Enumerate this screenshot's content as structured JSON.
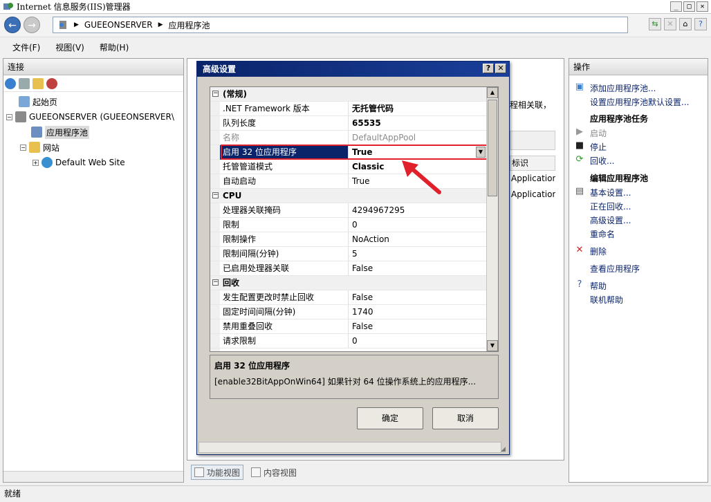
{
  "window": {
    "title": "Internet 信息服务(IIS)管理器",
    "controls": [
      "_",
      "□",
      "✕"
    ]
  },
  "address": {
    "crumbs": [
      "GUEEONSERVER",
      "应用程序池"
    ]
  },
  "menu": [
    "文件(F)",
    "视图(V)",
    "帮助(H)"
  ],
  "connections": {
    "header": "连接",
    "tree": {
      "start_page": "起始页",
      "server": "GUEEONSERVER (GUEEONSERVER\\",
      "app_pools": "应用程序池",
      "sites": "网站",
      "default_site": "Default Web Site"
    }
  },
  "center": {
    "text_fragment": "程相关联，",
    "col_header": "标识",
    "cells": [
      "Application",
      "Application"
    ],
    "view_tabs": [
      "功能视图",
      "内容视图"
    ]
  },
  "actions": {
    "header": "操作",
    "add_pool": "添加应用程序池...",
    "set_defaults": "设置应用程序池默认设置...",
    "tasks_heading": "应用程序池任务",
    "start": "启动",
    "stop": "停止",
    "recycle": "回收...",
    "edit_heading": "编辑应用程序池",
    "basic_settings": "基本设置...",
    "recycling": "正在回收...",
    "advanced_settings": "高级设置...",
    "rename": "重命名",
    "delete": "删除",
    "view_apps": "查看应用程序",
    "help": "帮助",
    "online_help": "联机帮助"
  },
  "status": "就绪",
  "dialog": {
    "title": "高级设置",
    "help_btn": "?",
    "close_btn": "✕",
    "categories": {
      "general": "(常规)",
      "cpu": "CPU",
      "recycling": "回收"
    },
    "props": {
      "p0": {
        "name": ".NET Framework 版本",
        "value": "无托管代码"
      },
      "p1": {
        "name": "队列长度",
        "value": "65535"
      },
      "p2": {
        "name": "名称",
        "value": "DefaultAppPool"
      },
      "p3": {
        "name": "启用 32 位应用程序",
        "value": "True"
      },
      "p4": {
        "name": "托管管道模式",
        "value": "Classic"
      },
      "p5": {
        "name": "自动启动",
        "value": "True"
      },
      "p6": {
        "name": "处理器关联掩码",
        "value": "4294967295"
      },
      "p7": {
        "name": "限制",
        "value": "0"
      },
      "p8": {
        "name": "限制操作",
        "value": "NoAction"
      },
      "p9": {
        "name": "限制间隔(分钟)",
        "value": "5"
      },
      "p10": {
        "name": "已启用处理器关联",
        "value": "False"
      },
      "p11": {
        "name": "发生配置更改时禁止回收",
        "value": "False"
      },
      "p12": {
        "name": "固定时间间隔(分钟)",
        "value": "1740"
      },
      "p13": {
        "name": "禁用重叠回收",
        "value": "False"
      },
      "p14": {
        "name": "请求限制",
        "value": "0"
      }
    },
    "description": {
      "title": "启用 32 位应用程序",
      "text": "[enable32BitAppOnWin64] 如果针对 64 位操作系统上的应用程序..."
    },
    "ok": "确定",
    "cancel": "取消"
  },
  "colors": {
    "highlight": "#e0202a",
    "dialog_title": "#0a246a",
    "link": "#0b246b"
  }
}
